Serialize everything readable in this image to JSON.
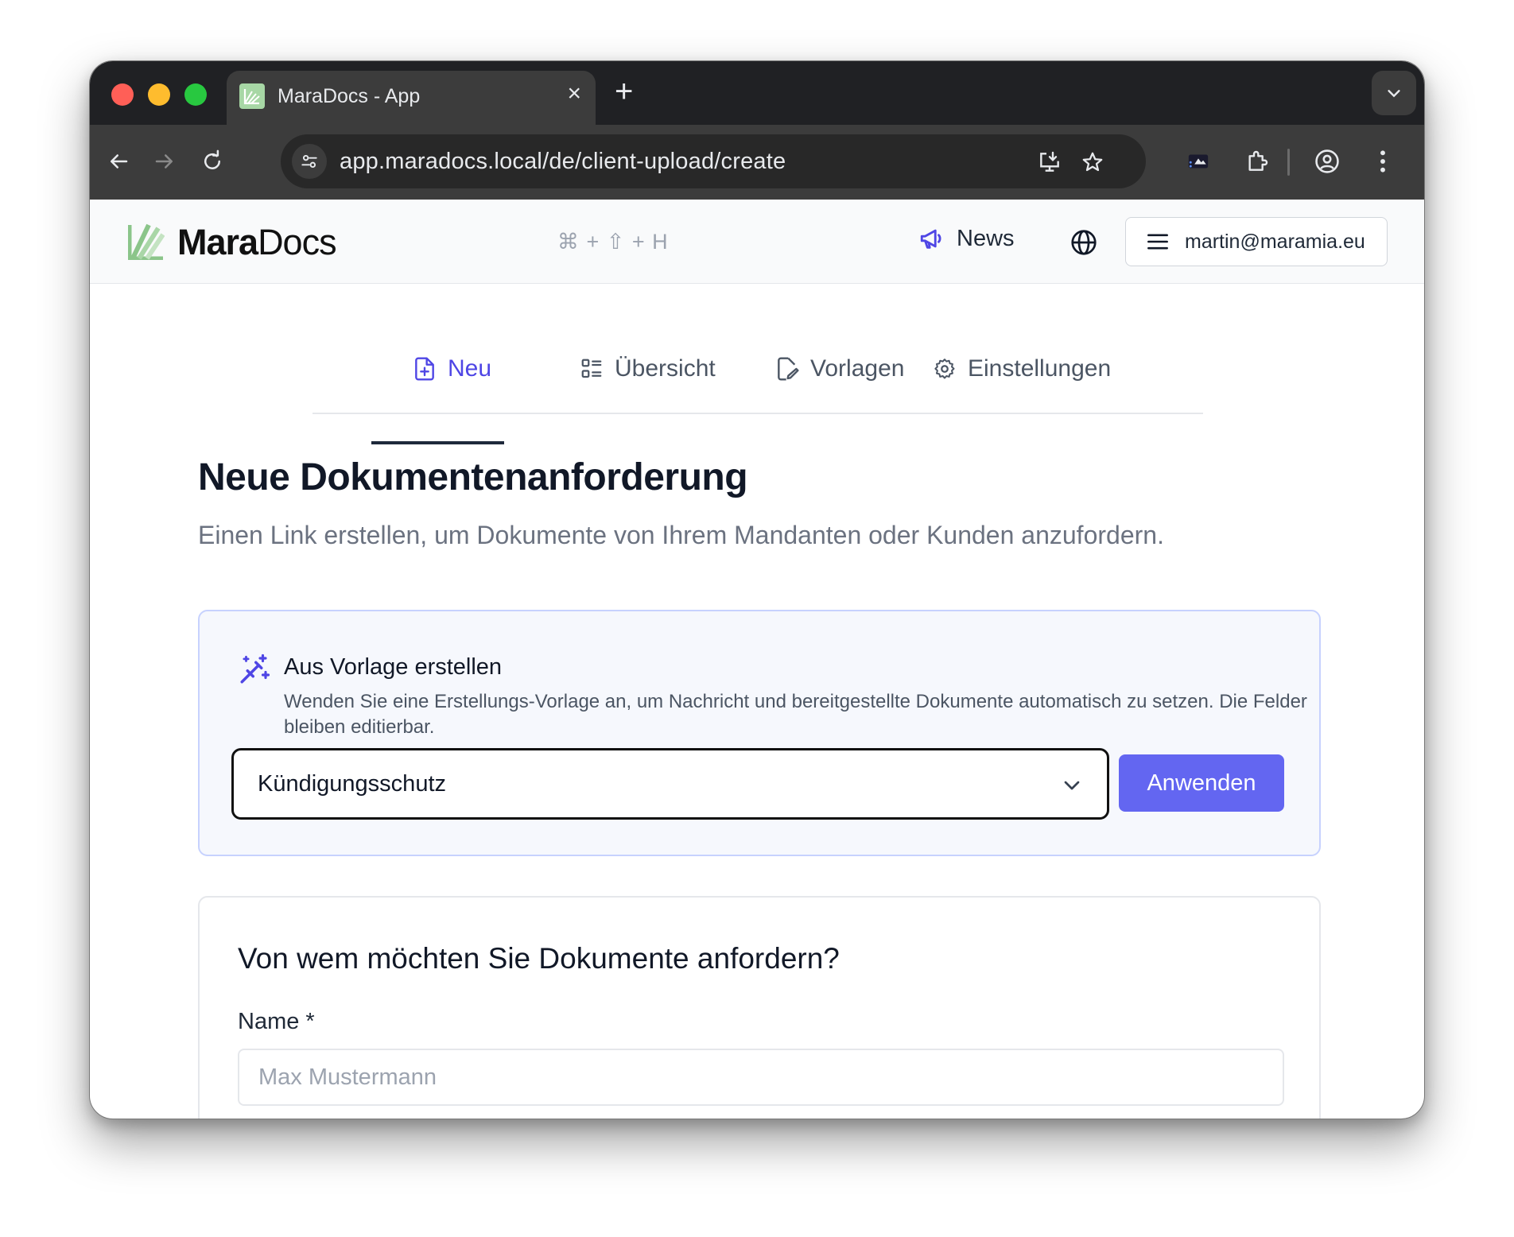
{
  "browser": {
    "tab_title": "MaraDocs - App",
    "tab_close": "×",
    "new_tab": "+",
    "url": "app.maradocs.local/de/client-upload/create"
  },
  "header": {
    "logo_part1": "Mara",
    "logo_part2": "Docs",
    "shortcut": "⌘ + ⇧ + H",
    "news_label": "News",
    "user_email": "martin@maramia.eu"
  },
  "tabs": [
    {
      "label": "Neu",
      "icon": "file-plus-icon",
      "active": true
    },
    {
      "label": "Übersicht",
      "icon": "list-icon",
      "active": false
    },
    {
      "label": "Vorlagen",
      "icon": "edit-file-icon",
      "active": false
    },
    {
      "label": "Einstellungen",
      "icon": "gear-icon",
      "active": false
    }
  ],
  "page": {
    "title": "Neue Dokumentenanforderung",
    "subtitle": "Einen Link erstellen, um Dokumente von Ihrem Mandanten oder Kunden anzufordern."
  },
  "template_card": {
    "title": "Aus Vorlage erstellen",
    "description": "Wenden Sie eine Erstellungs-Vorlage an, um Nachricht und bereitgestellte Dokumente automatisch zu setzen. Die Felder bleiben editierbar.",
    "selected": "Kündigungsschutz",
    "apply_label": "Anwenden"
  },
  "form_card": {
    "title": "Von wem möchten Sie Dokumente anfordern?",
    "name_label": "Name *",
    "name_placeholder": "Max Mustermann",
    "name_value": ""
  },
  "colors": {
    "accent": "#6366f1",
    "active_tab": "#4f46e5",
    "logo_green": "#8bc58a"
  }
}
